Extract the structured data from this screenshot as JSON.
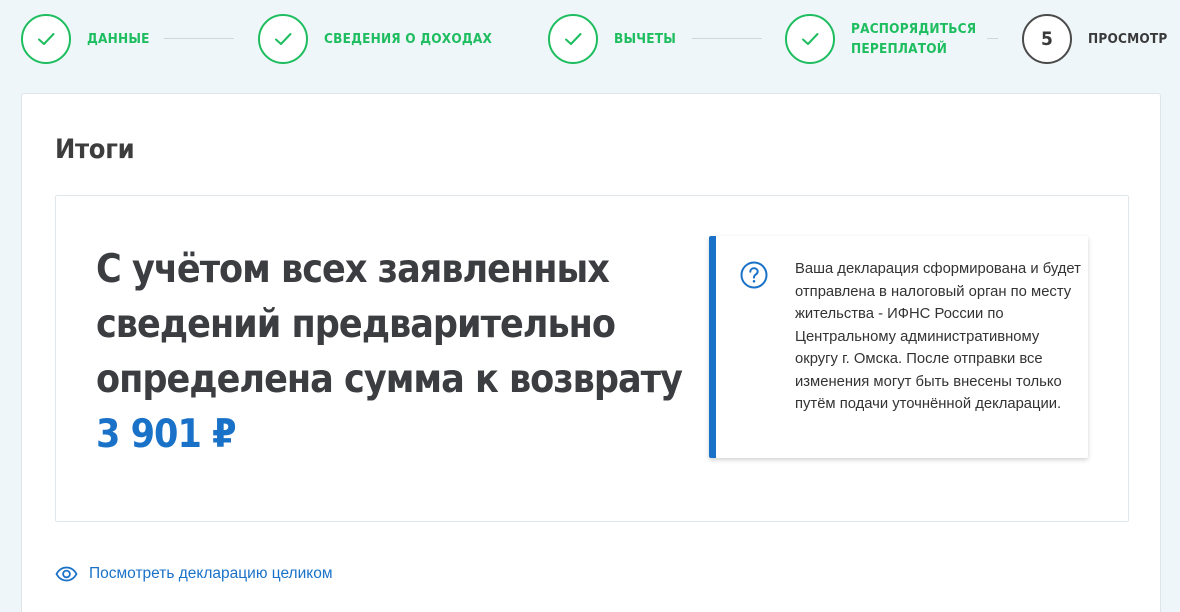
{
  "stepper": {
    "steps": [
      {
        "label": "Данные",
        "status": "done"
      },
      {
        "label": "Сведения о доходах",
        "status": "done"
      },
      {
        "label": "Вычеты",
        "status": "done"
      },
      {
        "label": "Распорядиться переплатой",
        "status": "done"
      },
      {
        "number": "5",
        "label": "Просмотр",
        "status": "current"
      }
    ]
  },
  "card": {
    "title": "Итоги",
    "result": {
      "text": "С учётом всех заявленных сведений предварительно определена сумма к возврату",
      "amount": "3 901 ₽"
    },
    "info": {
      "icon": "question-circle-icon",
      "text": "Ваша декларация сформирована и будет отправлена в налоговый орган по месту жительства - ИФНС России по Центральному административному округу г. Омска. После отправки все изменения могут быть внесены только путём подачи уточнённой декларации."
    },
    "view_link": {
      "icon": "eye-icon",
      "label": "Посмотреть декларацию целиком"
    }
  },
  "colors": {
    "page_background": "#eef6f9",
    "done_green": "#1ebd5f",
    "accent_blue": "#1a72c8",
    "text_dark": "#3b3d40"
  }
}
